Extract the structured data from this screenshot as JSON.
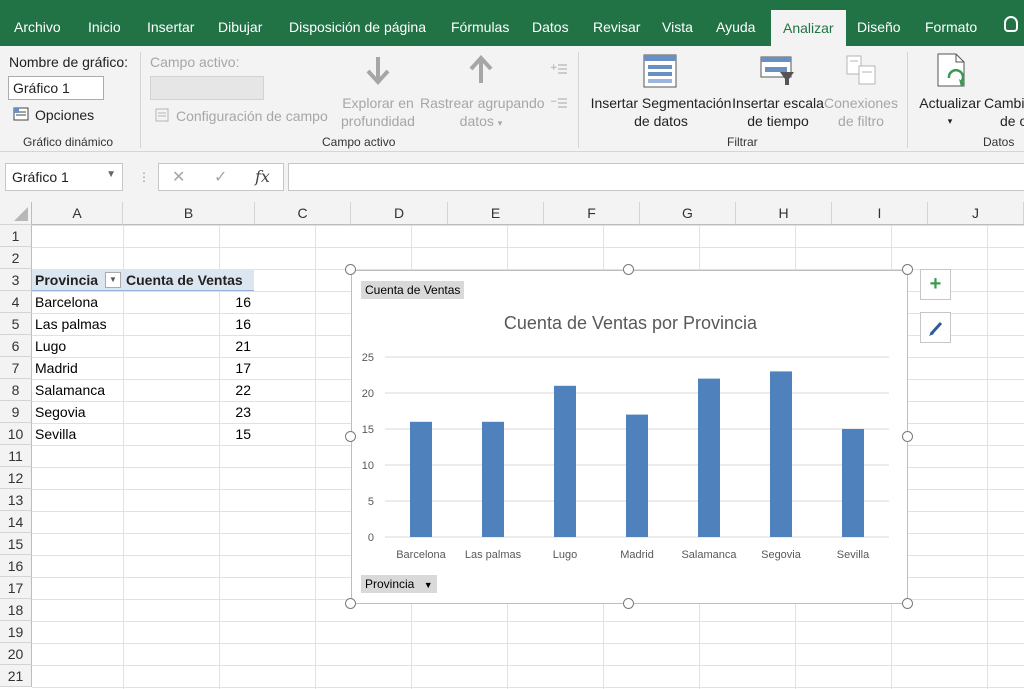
{
  "tabs": [
    "Archivo",
    "Inicio",
    "Insertar",
    "Dibujar",
    "Disposición de página",
    "Fórmulas",
    "Datos",
    "Revisar",
    "Vista",
    "Ayuda",
    "Analizar",
    "Diseño",
    "Formato"
  ],
  "active_tab": "Analizar",
  "ribbon": {
    "chart_name_label": "Nombre de gráfico:",
    "chart_name_value": "Gráfico 1",
    "options_label": "Opciones",
    "group_pivot": "Gráfico dinámico",
    "active_field_label": "Campo activo:",
    "field_config_label": "Configuración de campo",
    "drill_down_line1": "Explorar en",
    "drill_down_line2": "profundidad",
    "drill_up_line1": "Rastrear agrupando",
    "drill_up_line2": "datos",
    "group_active_field": "Campo activo",
    "slicer_line1": "Insertar Segmentación",
    "slicer_line2": "de datos",
    "timeline_line1": "Insertar escala",
    "timeline_line2": "de tiempo",
    "filter_conn_line1": "Conexiones",
    "filter_conn_line2": "de filtro",
    "group_filter": "Filtrar",
    "refresh_label": "Actualizar",
    "change_line1": "Cambi",
    "change_line2": "de o",
    "group_data": "Datos"
  },
  "formula_bar": {
    "name_box": "Gráfico 1",
    "cancel": "✕",
    "enter": "✓",
    "fx": "fx"
  },
  "columns": [
    "A",
    "B",
    "C",
    "D",
    "E",
    "F",
    "G",
    "H",
    "I",
    "J"
  ],
  "rows": [
    "1",
    "2",
    "3",
    "4",
    "5",
    "6",
    "7",
    "8",
    "9",
    "10",
    "11",
    "12",
    "13",
    "14",
    "15",
    "16",
    "17",
    "18",
    "19",
    "20",
    "21"
  ],
  "pivot": {
    "header_province": "Provincia",
    "header_count": "Cuenta de Ventas",
    "rows": [
      {
        "province": "Barcelona",
        "count": "16"
      },
      {
        "province": "Las palmas",
        "count": "16"
      },
      {
        "province": "Lugo",
        "count": "21"
      },
      {
        "province": "Madrid",
        "count": "17"
      },
      {
        "province": "Salamanca",
        "count": "22"
      },
      {
        "province": "Segovia",
        "count": "23"
      },
      {
        "province": "Sevilla",
        "count": "15"
      }
    ]
  },
  "chart_field_buttons": {
    "value_field": "Cuenta de Ventas",
    "axis_field": "Provincia"
  },
  "chart_data": {
    "type": "bar",
    "title": "Cuenta de Ventas por Provincia",
    "categories": [
      "Barcelona",
      "Las palmas",
      "Lugo",
      "Madrid",
      "Salamanca",
      "Segovia",
      "Sevilla"
    ],
    "values": [
      16,
      16,
      21,
      17,
      22,
      23,
      15
    ],
    "ylim": [
      0,
      25
    ],
    "yticks": [
      0,
      5,
      10,
      15,
      20,
      25
    ],
    "grid": true,
    "bar_color": "#4f81bd"
  },
  "colors": {
    "accent": "#217346",
    "pivot_header": "#dce6f1"
  }
}
